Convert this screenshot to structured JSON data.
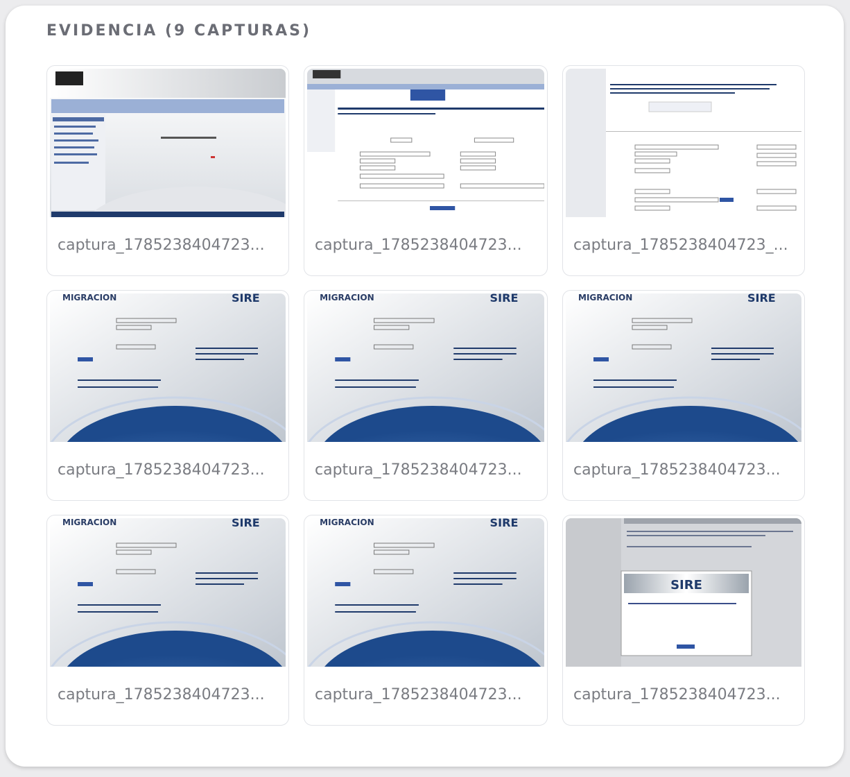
{
  "section": {
    "title": "EVIDENCIA (9 CAPTURAS)"
  },
  "captures": [
    {
      "caption": "captura_1785238404723...",
      "kind": "portal"
    },
    {
      "caption": "captura_1785238404723...",
      "kind": "form"
    },
    {
      "caption": "captura_1785238404723_...",
      "kind": "detail"
    },
    {
      "caption": "captura_1785238404723...",
      "kind": "login"
    },
    {
      "caption": "captura_1785238404723...",
      "kind": "login"
    },
    {
      "caption": "captura_1785238404723...",
      "kind": "login"
    },
    {
      "caption": "captura_1785238404723...",
      "kind": "login"
    },
    {
      "caption": "captura_1785238404723...",
      "kind": "login"
    },
    {
      "caption": "captura_1785238404723...",
      "kind": "dialog"
    }
  ],
  "thumb_text": {
    "sire": "SIRE",
    "migracion": "MIGRACION"
  },
  "colors": {
    "navy": "#1f3a6b",
    "globe": "#3a6aa8",
    "nav_blue": "#9bb0d6"
  }
}
